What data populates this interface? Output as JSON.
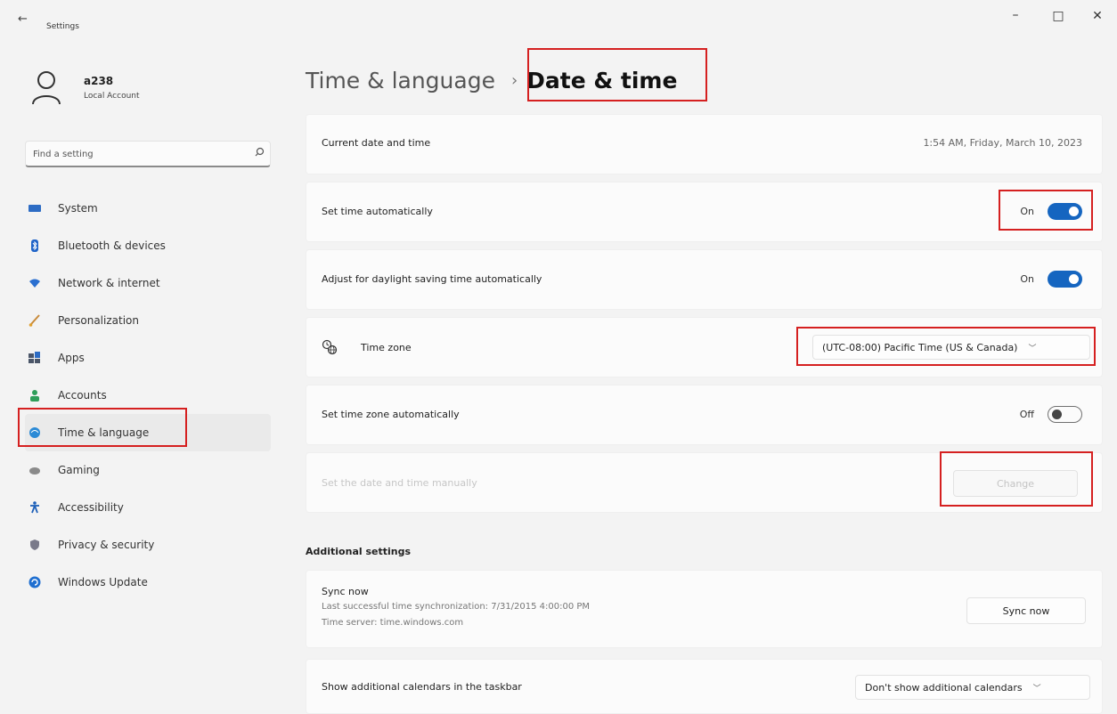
{
  "window": {
    "title": "Settings",
    "back_glyph": "←",
    "minimize_glyph": "–",
    "maximize_glyph": "□",
    "close_glyph": "✕"
  },
  "profile": {
    "name": "a238",
    "account_type": "Local Account"
  },
  "search": {
    "placeholder": "Find a setting",
    "icon": "search-icon"
  },
  "sidebar": {
    "items": [
      {
        "label": "System",
        "icon": "monitor-icon",
        "color": "#2d6cc4"
      },
      {
        "label": "Bluetooth & devices",
        "icon": "bluetooth-icon",
        "color": "#1f64c8"
      },
      {
        "label": "Network & internet",
        "icon": "wifi-icon",
        "color": "#2a6fd0"
      },
      {
        "label": "Personalization",
        "icon": "brush-icon",
        "color": "#c88a3a"
      },
      {
        "label": "Apps",
        "icon": "apps-icon",
        "color": "#4a5568"
      },
      {
        "label": "Accounts",
        "icon": "person-icon",
        "color": "#2f9e5a"
      },
      {
        "label": "Time & language",
        "icon": "globe-clock-icon",
        "color": "#2b8ad6",
        "active": true
      },
      {
        "label": "Gaming",
        "icon": "controller-icon",
        "color": "#8a8a8a"
      },
      {
        "label": "Accessibility",
        "icon": "accessibility-icon",
        "color": "#1d5fb8"
      },
      {
        "label": "Privacy & security",
        "icon": "shield-icon",
        "color": "#7a7a8a"
      },
      {
        "label": "Windows Update",
        "icon": "update-icon",
        "color": "#1f6fd0"
      }
    ]
  },
  "breadcrumb": {
    "parent": "Time & language",
    "separator": "›",
    "current": "Date & time"
  },
  "settings": {
    "current": {
      "label": "Current date and time",
      "value": "1:54 AM, Friday, March 10, 2023"
    },
    "auto_time": {
      "label": "Set time automatically",
      "state": "On"
    },
    "dst": {
      "label": "Adjust for daylight saving time automatically",
      "state": "On"
    },
    "timezone": {
      "label": "Time zone",
      "value": "(UTC-08:00) Pacific Time (US & Canada)"
    },
    "auto_timezone": {
      "label": "Set time zone automatically",
      "state": "Off"
    },
    "manual": {
      "label": "Set the date and time manually",
      "button": "Change"
    }
  },
  "additional": {
    "title": "Additional settings",
    "sync": {
      "title": "Sync now",
      "last_sync": "Last successful time synchronization: 7/31/2015 4:00:00 PM",
      "server": "Time server: time.windows.com",
      "button": "Sync now"
    },
    "calendars": {
      "label": "Show additional calendars in the taskbar",
      "value": "Don't show additional calendars"
    }
  },
  "colors": {
    "accent": "#1565c0",
    "highlight": "#d52020"
  }
}
